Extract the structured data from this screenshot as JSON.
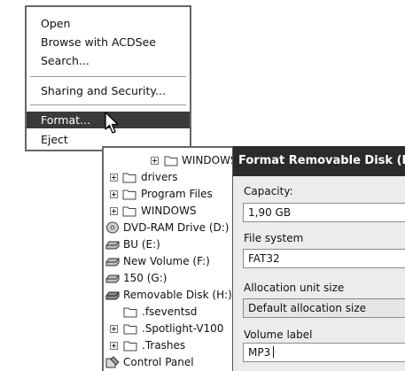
{
  "context_menu": {
    "items": [
      {
        "label": "Open"
      },
      {
        "label": "Browse with ACDSee"
      },
      {
        "label": "Search..."
      },
      {
        "label": "Sharing and Security..."
      },
      {
        "label": "Format..."
      },
      {
        "label": "Eject"
      }
    ],
    "selected": "Format..."
  },
  "tree": {
    "items": [
      {
        "label": "WINDOWS",
        "icon": "folder-icon"
      },
      {
        "label": "drivers",
        "icon": "folder-icon"
      },
      {
        "label": "Program Files",
        "icon": "folder-icon"
      },
      {
        "label": "WINDOWS",
        "icon": "folder-icon"
      },
      {
        "label": "DVD-RAM Drive (D:)",
        "icon": "dvd-drive-icon"
      },
      {
        "label": "BU (E:)",
        "icon": "drive-icon"
      },
      {
        "label": "New Volume (F:)",
        "icon": "drive-icon"
      },
      {
        "label": "150  (G:)",
        "icon": "drive-icon"
      },
      {
        "label": "Removable Disk (H:)",
        "icon": "removable-drive-icon"
      },
      {
        "label": ".fseventsd",
        "icon": "folder-icon"
      },
      {
        "label": ".Spotlight-V100",
        "icon": "folder-icon"
      },
      {
        "label": ".Trashes",
        "icon": "folder-icon"
      },
      {
        "label": "Control Panel",
        "icon": "control-panel-icon"
      }
    ]
  },
  "dialog": {
    "title": "Format Removable Disk (H:",
    "capacity_label": "Capacity:",
    "capacity_value": "1,90 GB",
    "filesystem_label": "File system",
    "filesystem_value": "FAT32",
    "allocation_label": "Allocation unit size",
    "allocation_value": "Default allocation size",
    "volume_label": "Volume label",
    "volume_value": "MP3"
  }
}
